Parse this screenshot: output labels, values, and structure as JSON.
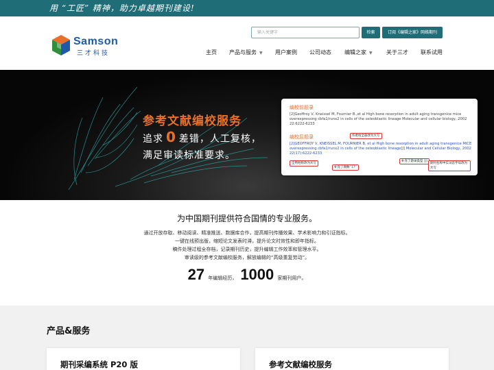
{
  "topbar": {
    "slogan": "用 “工匠” 精神，助力卓越期刊建设!"
  },
  "logo": {
    "name": "Samson",
    "subtitle": "三才科技"
  },
  "search": {
    "placeholder": "输入关键字",
    "button": "检索"
  },
  "subscribe_button": "订阅《编辑之家》网络期刊",
  "nav": {
    "items": [
      {
        "label": "主页",
        "dropdown": false
      },
      {
        "label": "产品与服务",
        "dropdown": true
      },
      {
        "label": "用户案例",
        "dropdown": false
      },
      {
        "label": "公司动态",
        "dropdown": false
      },
      {
        "label": "编辑之家",
        "dropdown": true
      },
      {
        "label": "关于三才",
        "dropdown": false
      },
      {
        "label": "联系试用",
        "dropdown": false
      }
    ]
  },
  "hero": {
    "title": "参考文献编校服务",
    "line1_pre": "追求",
    "zero": "0",
    "line1_post": "差错，人工复核，",
    "line2": "满足审读标准要求。",
    "card": {
      "before_label": "编校前题录",
      "before_text": "[2]Geoffroy V, Kneissel M, Fournier B.,et al High bone resorption in adult aging transgenice mice overexpressing cbfa1/runx2 in cells of the osteoblastic lineage Molecular and cellular biology, 2002 22:6222-6233",
      "after_label": "编校后题录",
      "after_text": "[2]GEOFFROY V, KNEISSEL M, FOURNIER B, et al High bone resorption in adult aging transgenice MICE overexpressing cbfa1/runx2 in cells of the osteoblastic lineage[J] Molecular and Cellular Biology, 2002 22(17):6222-6233",
      "annotations": {
        "author": "作者姓全部改为大写",
        "surname": "全用姓称改为大写",
        "issue": "补充了期数“17”",
        "type": "补充了题录类型 [J]",
        "journal": "期刊名称中实词首字母改为大写"
      }
    }
  },
  "intro": {
    "title": "为中国期刊提供符合国情的专业服务。",
    "lines": [
      "通过开放存取、移动阅读、精准推送、数据库合作，提高期刊传播效果、学术影响力和引证指标。",
      "一键在线预出版，缩短论文发表时滞，提升论文时效性和即年指标。",
      "稿件处理过程全存档，记录期刊历史，提升编辑工作效率和管理水平。",
      "审读级的参考文献编校服务，解放编辑的“高级重复劳动”。"
    ],
    "stat1_value": "27",
    "stat1_label": "年编辑经历，",
    "stat2_value": "1000",
    "stat2_label": "家期刊用户。"
  },
  "products": {
    "title": "产品&服务",
    "cards": [
      {
        "title": "期刊采编系统 P20 版"
      },
      {
        "title": "参考文献编校服务"
      }
    ]
  },
  "colors": {
    "teal": "#1f6d77",
    "orange": "#e8702a",
    "brand_blue": "#1e5aa8"
  }
}
